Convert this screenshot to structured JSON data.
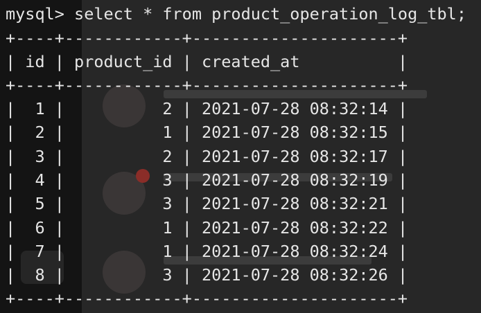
{
  "terminal": {
    "prompt": "mysql> ",
    "command": "select * from product_operation_log_tbl;",
    "border": "+----+------------+---------------------+",
    "columns": [
      "id",
      "product_id",
      "created_at"
    ],
    "rows": [
      {
        "id": "1",
        "product_id": "2",
        "created_at": "2021-07-28 08:32:14"
      },
      {
        "id": "2",
        "product_id": "1",
        "created_at": "2021-07-28 08:32:15"
      },
      {
        "id": "3",
        "product_id": "2",
        "created_at": "2021-07-28 08:32:17"
      },
      {
        "id": "4",
        "product_id": "3",
        "created_at": "2021-07-28 08:32:19"
      },
      {
        "id": "5",
        "product_id": "3",
        "created_at": "2021-07-28 08:32:21"
      },
      {
        "id": "6",
        "product_id": "1",
        "created_at": "2021-07-28 08:32:22"
      },
      {
        "id": "7",
        "product_id": "1",
        "created_at": "2021-07-28 08:32:24"
      },
      {
        "id": "8",
        "product_id": "3",
        "created_at": "2021-07-28 08:32:26"
      }
    ]
  },
  "colors": {
    "background": "#101010",
    "text": "#e6e6e6"
  }
}
